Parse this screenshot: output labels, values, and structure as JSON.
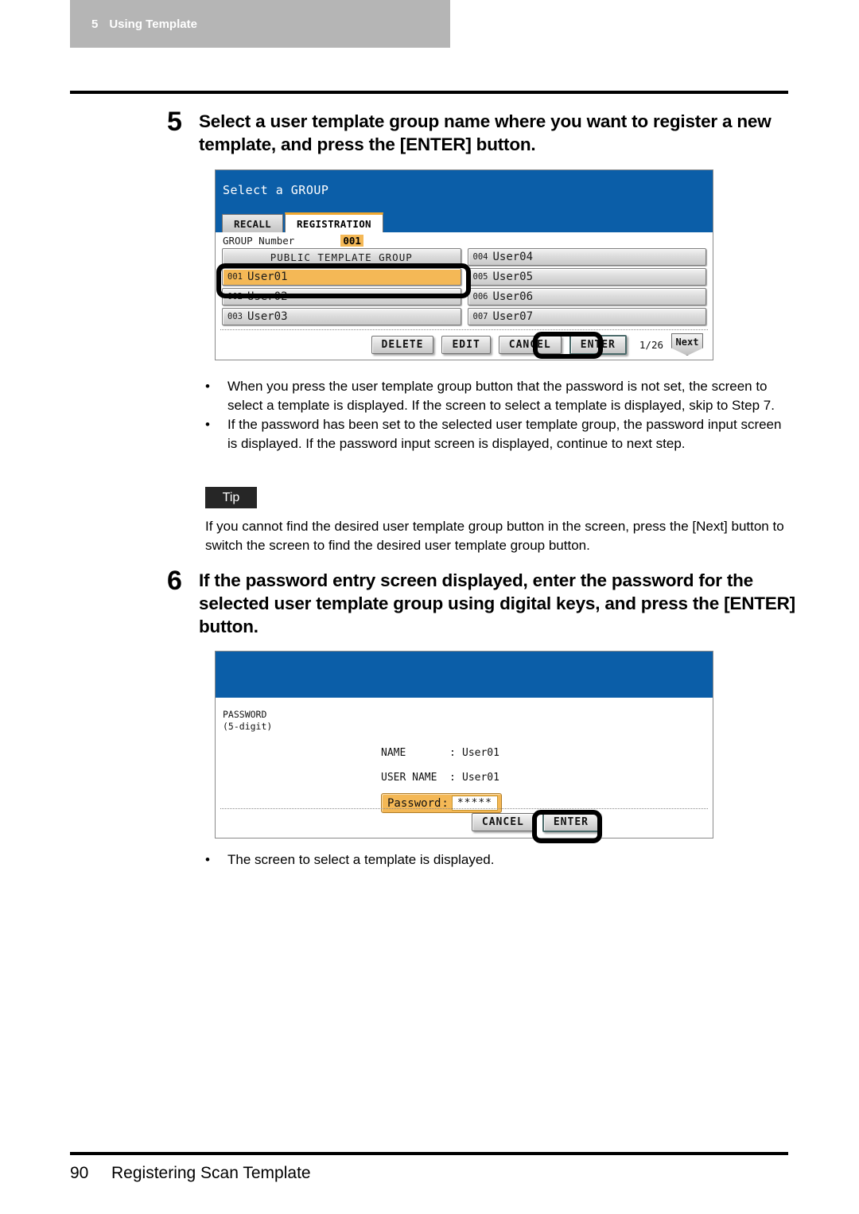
{
  "running_header": {
    "chapter_number": "5",
    "chapter_title": "Using Template"
  },
  "steps": [
    {
      "number": "5",
      "text": "Select a user template group name where you want to register a new template, and press the [ENTER] button."
    },
    {
      "number": "6",
      "text": "If the password entry screen displayed, enter the password for the selected user template group using digital keys, and press the [ENTER] button."
    }
  ],
  "group_screen": {
    "title": "Select a GROUP",
    "tabs": [
      {
        "label": "RECALL",
        "active": false
      },
      {
        "label": "REGISTRATION",
        "active": true
      }
    ],
    "group_number_label": "GROUP Number",
    "group_number_value": "001",
    "groups": [
      {
        "number": "",
        "name": "PUBLIC TEMPLATE GROUP",
        "public": true,
        "selected": false
      },
      {
        "number": "004",
        "name": "User04",
        "public": false,
        "selected": false
      },
      {
        "number": "001",
        "name": "User01",
        "public": false,
        "selected": true
      },
      {
        "number": "005",
        "name": "User05",
        "public": false,
        "selected": false
      },
      {
        "number": "002",
        "name": "User02",
        "public": false,
        "selected": false
      },
      {
        "number": "006",
        "name": "User06",
        "public": false,
        "selected": false
      },
      {
        "number": "003",
        "name": "User03",
        "public": false,
        "selected": false
      },
      {
        "number": "007",
        "name": "User07",
        "public": false,
        "selected": false
      }
    ],
    "buttons": {
      "delete": "DELETE",
      "edit": "EDIT",
      "cancel": "CANCEL",
      "enter": "ENTER",
      "next": "Next"
    },
    "page_indicator": "1/26",
    "colors": {
      "header_blue": "#0b5ea8",
      "selection_orange": "#f4b856",
      "active_tab_accent": "#f0a830"
    }
  },
  "password_screen": {
    "password_label_line1": "PASSWORD",
    "password_label_line2": "(5-digit)",
    "fields": [
      {
        "key": "NAME",
        "colon": ":",
        "value": "User01"
      },
      {
        "key": "USER NAME",
        "colon": ":",
        "value": "User01"
      }
    ],
    "password_input": {
      "label": "Password",
      "colon": ":",
      "value": "*****"
    },
    "buttons": {
      "cancel": "CANCEL",
      "enter": "ENTER"
    }
  },
  "notes_after_step5": [
    "When you press the user template group button that the password is not set, the screen to select a template is displayed.  If the screen to select a template is displayed, skip to Step 7.",
    "If the password has been set to the selected user template group, the password input screen is displayed.  If the password input screen is displayed, continue to next step."
  ],
  "tip": {
    "badge": "Tip",
    "text": "If you cannot find the desired user template group button in the screen, press the [Next] button to switch the screen to find the desired user template group button."
  },
  "notes_after_step6": [
    "The screen to select a template is displayed."
  ],
  "footer": {
    "page_number": "90",
    "section_title": "Registering Scan Template"
  },
  "bullet_glyph": "•"
}
